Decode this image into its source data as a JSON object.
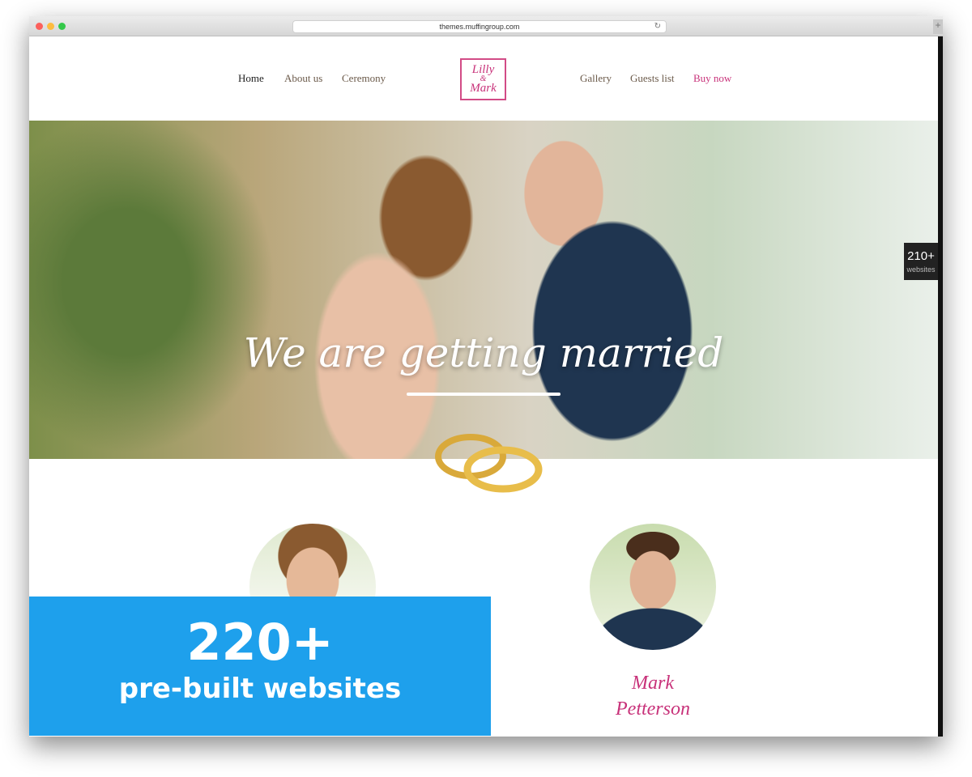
{
  "browser": {
    "url": "themes.muffingroup.com"
  },
  "nav": {
    "left": [
      "Home",
      "About us",
      "Ceremony"
    ],
    "right": [
      "Gallery",
      "Guests list",
      "Buy now"
    ],
    "logo_line1": "Lilly",
    "logo_amp": "&",
    "logo_line2": "Mark"
  },
  "hero": {
    "title": "We are getting married"
  },
  "side_badge": {
    "count": "210+",
    "label": "websites"
  },
  "couple": {
    "groom_first": "Mark",
    "groom_last": "Petterson"
  },
  "promo": {
    "count": "220+",
    "text": "pre-built websites"
  },
  "colors": {
    "accent": "#c8327a",
    "promo": "#1ea0ec"
  }
}
